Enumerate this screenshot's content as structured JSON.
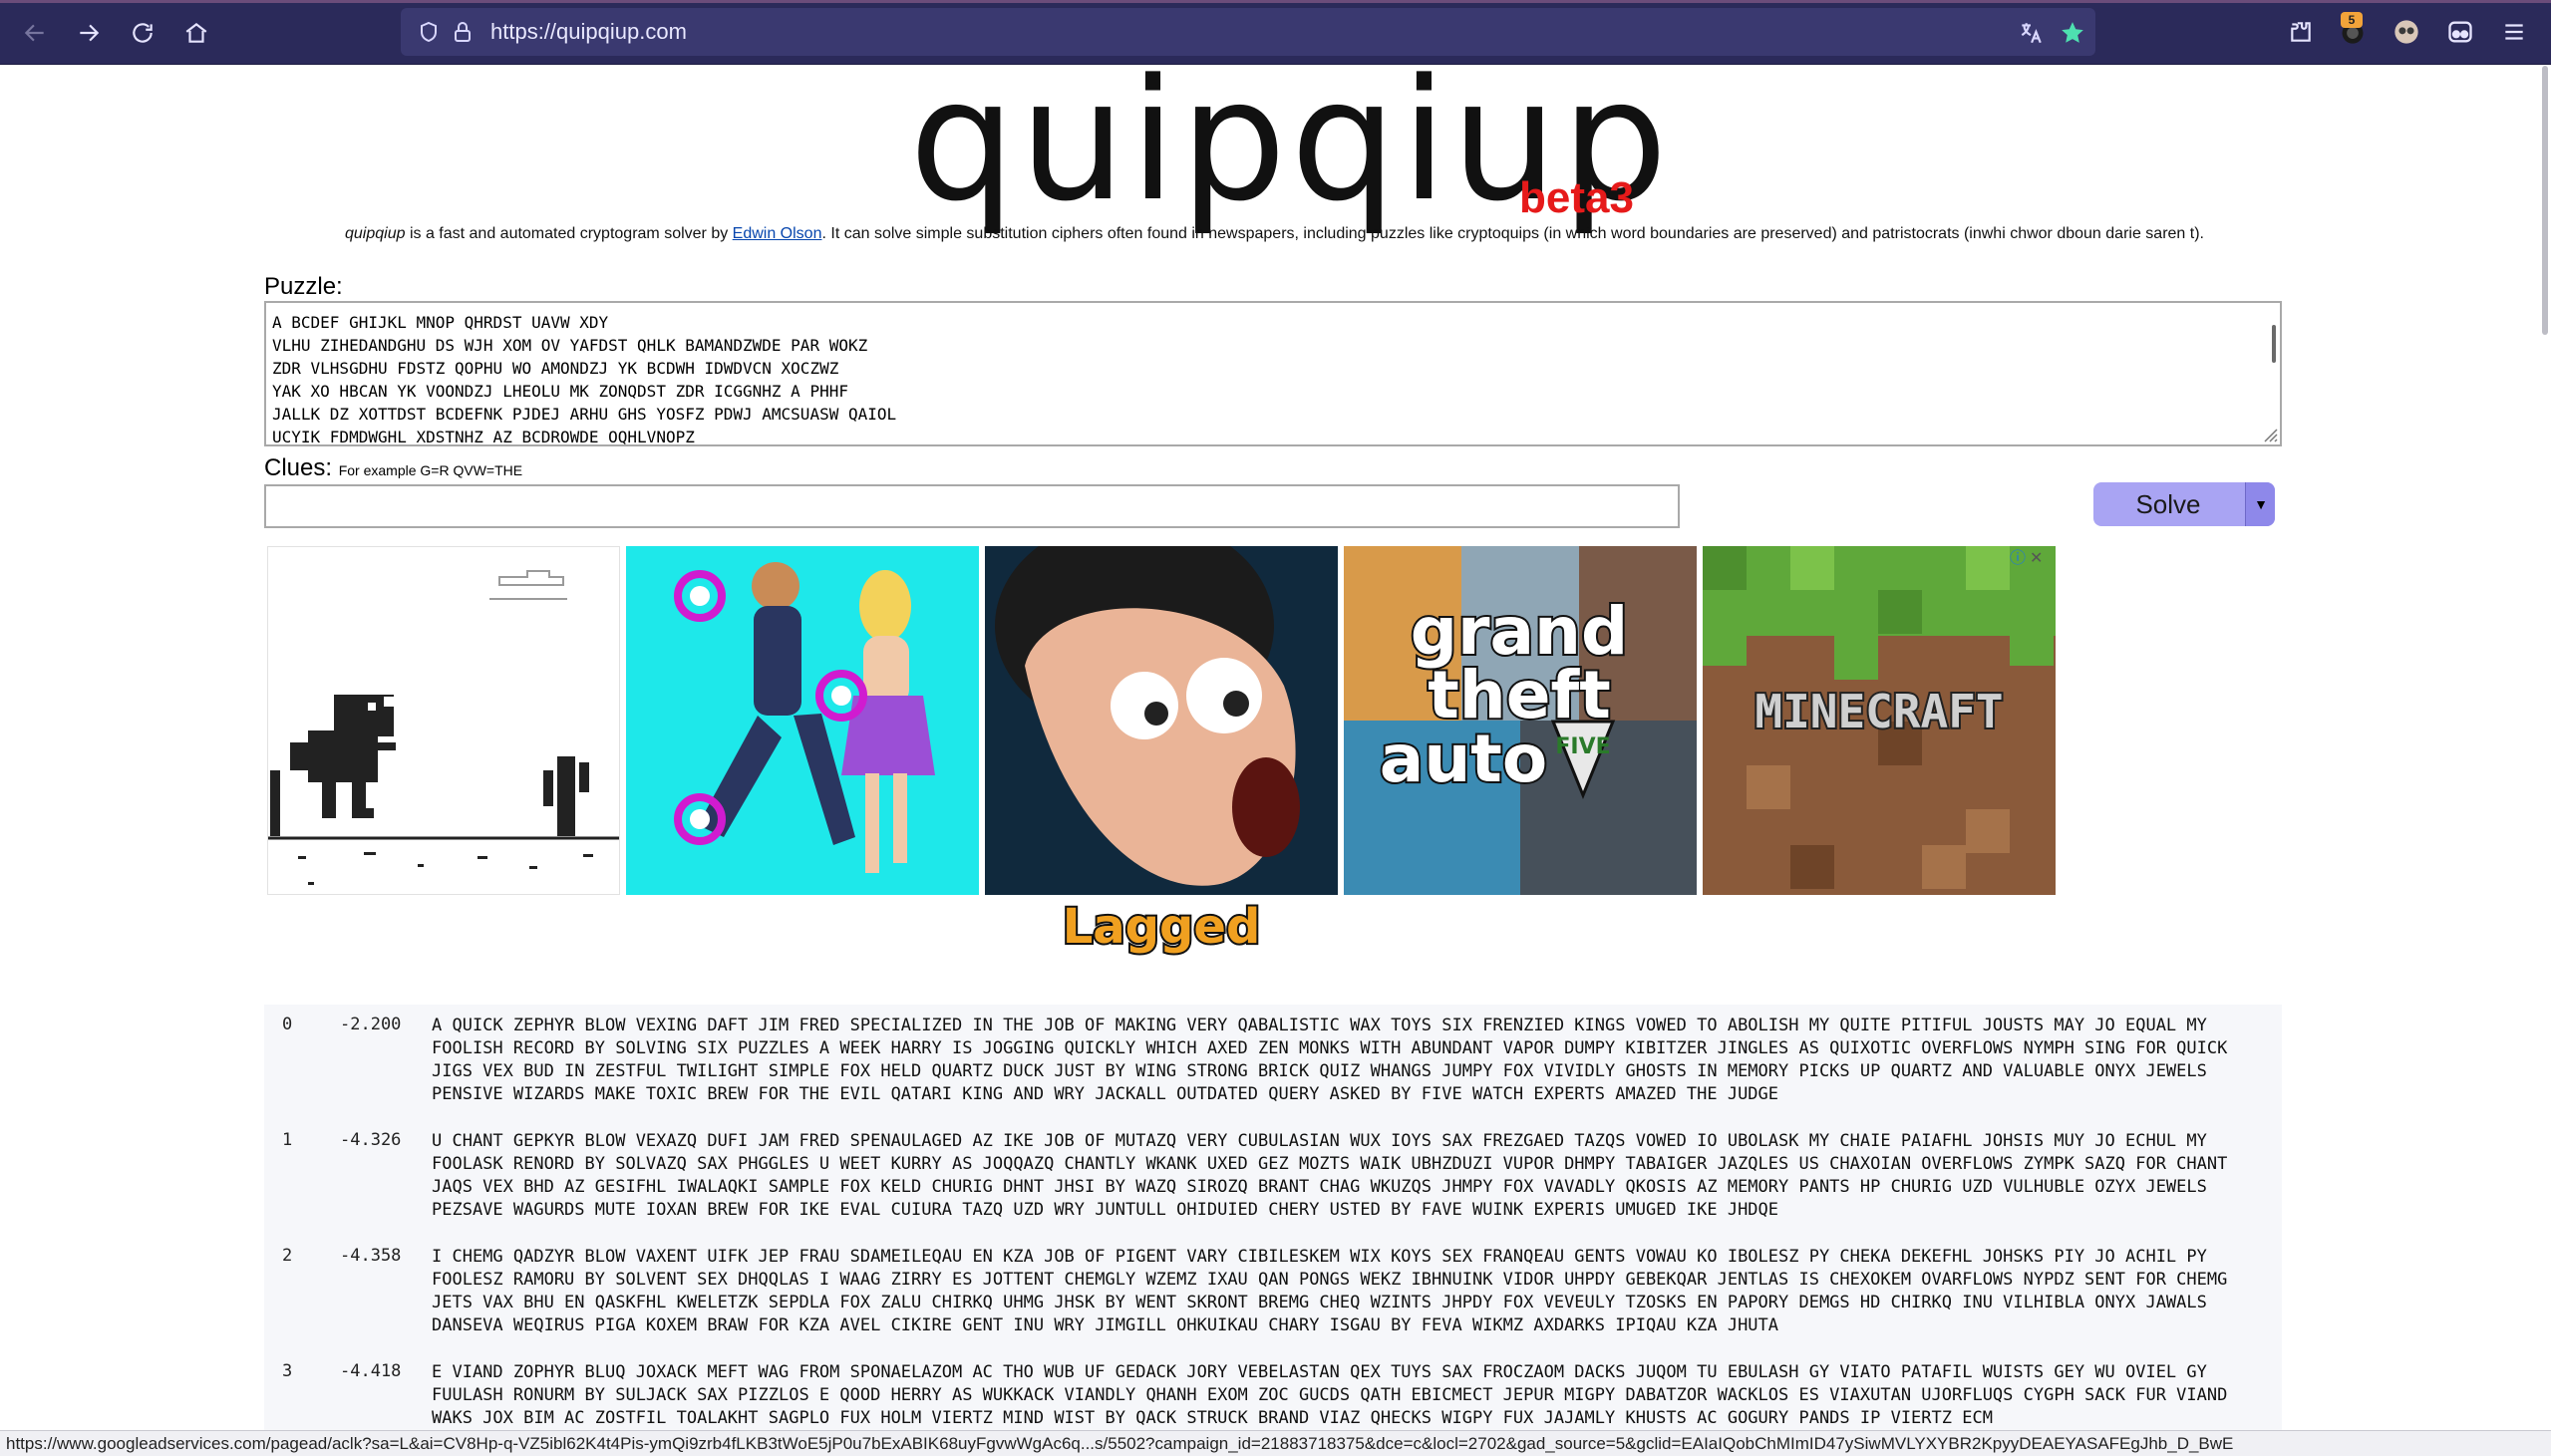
{
  "browser": {
    "url": "https://quipqiup.com",
    "badge_count": "5",
    "accent": "#2b2a5a"
  },
  "page": {
    "logo": "quipqiup",
    "beta": "beta3",
    "intro_italic": "quipqiup",
    "intro_before_link": " is a fast and automated cryptogram solver by ",
    "intro_link": "Edwin Olson",
    "intro_after_link": ". It can solve simple substitution ciphers often found in newspapers, including puzzles like cryptoquips (in which word boundaries are preserved) and patristocrats (inwhi chwor dboun darie saren t).",
    "puzzle_label": "Puzzle:",
    "puzzle_text": "A BCDEF GHIJKL MNOP QHRDST UAVW XDY\nVLHU ZIHEDANDGHU DS WJH XOM OV YAFDST QHLK BAMANDZWDE PAR WOKZ\nZDR VLHSGDHU FDSTZ QOPHU WO AMONDZJ YK BCDWH IDWDVCN XOCZWZ\nYAK XO HBCAN YK VOONDZJ LHEOLU MK ZONQDST ZDR ICGGNHZ A PHHF\nJALLK DZ XOTTDST BCDEFNK PJDEJ ARHU GHS YOSFZ PDWJ AMCSUASW QAIOL\nUCYIK FDMDWGHL XDSTNHZ AZ BCDROWDE OQHLVNOPZ",
    "clues_label": "Clues:",
    "clues_hint": "For example G=R QVW=THE",
    "clues_value": "",
    "solve_label": "Solve",
    "lagged_logo": "Lagged"
  },
  "ad": {
    "tiles": [
      "dinosaur-runner-game",
      "dance-couple-game",
      "stretchy-face-game",
      "grand-theft-auto-five",
      "minecraft"
    ],
    "gta_text_1": "grand",
    "gta_text_2": "theft",
    "gta_text_3": "auto",
    "gta_text_4": "FIVE",
    "minecraft_text": "MINECRAFT"
  },
  "results": [
    {
      "index": "0",
      "score": "-2.200",
      "text": "A QUICK ZEPHYR BLOW VEXING DAFT JIM FRED SPECIALIZED IN THE JOB OF MAKING VERY QABALISTIC WAX TOYS SIX FRENZIED KINGS VOWED TO ABOLISH MY QUITE PITIFUL JOUSTS MAY JO EQUAL MY FOOLISH RECORD BY SOLVING SIX PUZZLES A WEEK HARRY IS JOGGING QUICKLY WHICH AXED ZEN MONKS WITH ABUNDANT VAPOR DUMPY KIBITZER JINGLES AS QUIXOTIC OVERFLOWS NYMPH SING FOR QUICK JIGS VEX BUD IN ZESTFUL TWILIGHT SIMPLE FOX HELD QUARTZ DUCK JUST BY WING STRONG BRICK QUIZ WHANGS JUMPY FOX VIVIDLY GHOSTS IN MEMORY PICKS UP QUARTZ AND VALUABLE ONYX JEWELS PENSIVE WIZARDS MAKE TOXIC BREW FOR THE EVIL QATARI KING AND WRY JACKALL OUTDATED QUERY ASKED BY FIVE WATCH EXPERTS AMAZED THE JUDGE"
    },
    {
      "index": "1",
      "score": "-4.326",
      "text": "U CHANT GEPKYR BLOW VEXAZQ DUFI JAM FRED SPENAULAGED AZ IKE JOB OF MUTAZQ VERY CUBULASIAN WUX IOYS SAX FREZGAED TAZQS VOWED IO UBOLASK MY CHAIE PAIAFHL JOHSIS MUY JO ECHUL MY FOOLASK RENORD BY SOLVAZQ SAX PHGGLES U WEET KURRY AS JOQQAZQ CHANTLY WKANK UXED GEZ MOZTS WAIK UBHZDUZI VUPOR DHMPY TABAIGER JAZQLES US CHAXOIAN OVERFLOWS ZYMPK SAZQ FOR CHANT JAQS VEX BHD AZ GESIFHL IWALAQKI SAMPLE FOX KELD CHURIG DHNT JHSI BY WAZQ SIROZQ BRANT CHAG WKUZQS JHMPY FOX VAVADLY QKOSIS AZ MEMORY PANTS HP CHURIG UZD VULHUBLE OZYX JEWELS PEZSAVE WAGURDS MUTE IOXAN BREW FOR IKE EVAL CUIURA TAZQ UZD WRY JUNTULL OHIDUIED CHERY USTED BY FAVE WUINK EXPERIS UMUGED IKE JHDQE"
    },
    {
      "index": "2",
      "score": "-4.358",
      "text": "I CHEMG QADZYR BLOW VAXENT UIFK JEP FRAU SDAMEILEQAU EN KZA JOB OF PIGENT VARY CIBILESKEM WIX KOYS SEX FRANQEAU GENTS VOWAU KO IBOLESZ PY CHEKA DEKEFHL JOHSKS PIY JO ACHIL PY FOOLESZ RAMORU BY SOLVENT SEX DHQQLAS I WAAG ZIRRY ES JOTTENT CHEMGLY WZEMZ IXAU QAN PONGS WEKZ IBHNUINK VIDOR UHPDY GEBEKQAR JENTLAS IS CHEXOKEM OVARFLOWS NYPDZ SENT FOR CHEMG JETS VAX BHU EN QASKFHL KWELETZK SEPDLA FOX ZALU CHIRKQ UHMG JHSK BY WENT SKRONT BREMG CHEQ WZINTS JHPDY FOX VEVEULY TZOSKS EN PAPORY DEMGS HD CHIRKQ INU VILHIBLA ONYX JAWALS DANSEVA WEQIRUS PIGA KOXEM BRAW FOR KZA AVEL CIKIRE GENT INU WRY JIMGILL OHKUIKAU CHARY ISGAU BY FEVA WIKMZ AXDARKS IPIQAU KZA JHUTA"
    },
    {
      "index": "3",
      "score": "-4.418",
      "text": "E VIAND ZOPHYR BLUQ JOXACK MEFT WAG FROM SPONAELAZOM AC THO WUB UF GEDACK JORY VEBELASTAN QEX TUYS SAX FROCZAOM DACKS JUQOM TU EBULASH GY VIATO PATAFIL WUISTS GEY WU OVIEL GY FUULASH RONURM BY SULJACK SAX PIZZLOS E QOOD HERRY AS WUKKACK VIANDLY QHANH EXOM ZOC GUCDS QATH EBICMECT JEPUR MIGPY DABATZOR WACKLOS ES VIAXUTAN UJORFLUQS CYGPH SACK FUR VIAND WAKS JOX BIM AC ZOSTFIL TOALAKHT SAGPLO FUX HOLM VIERTZ MIND WIST BY QACK STRUCK BRAND VIAZ QHECKS WIGPY FUX JAJAMLY KHUSTS AC GOGURY PANDS IP VIERTZ ECM"
    }
  ],
  "statusbar": {
    "text": "https://www.googleadservices.com/pagead/aclk?sa=L&ai=CV8Hp-q-VZ5ibl62K4t4Pis-ymQi9zrb4fLKB3tWoE5jP0u7bExABIK68uyFgvwWgAc6q...s/5502?campaign_id=21883718375&dce=c&locl=2702&gad_source=5&gclid=EAIaIQobChMImID47ySiwMVLYXYBR2KpyyDEAEYASAFEgJhb_D_BwE"
  }
}
